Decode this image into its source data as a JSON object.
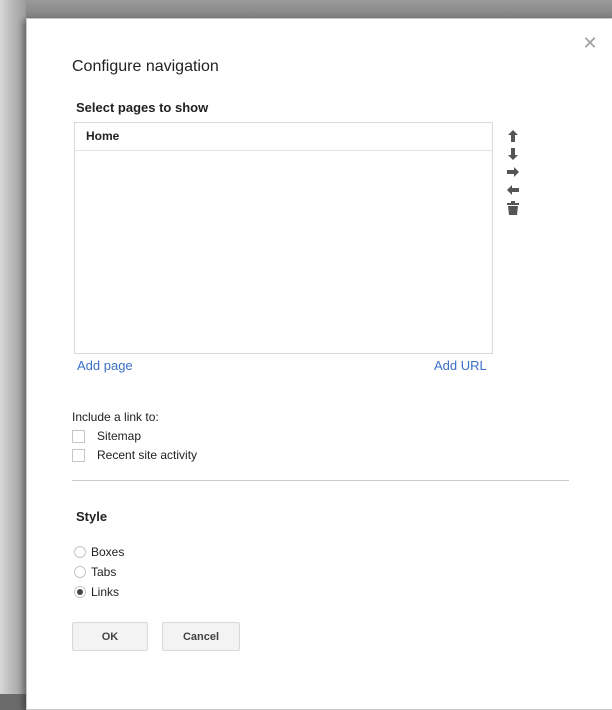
{
  "dialog": {
    "title": "Configure navigation",
    "close_icon": "close-icon"
  },
  "pages_section": {
    "label": "Select pages to show",
    "pages": [
      "Home"
    ],
    "add_page_label": "Add page",
    "add_url_label": "Add URL",
    "tools": [
      "move-up-icon",
      "move-down-icon",
      "indent-right-icon",
      "indent-left-icon",
      "trash-icon"
    ]
  },
  "include_section": {
    "label": "Include a link to:",
    "options": [
      {
        "label": "Sitemap",
        "checked": false
      },
      {
        "label": "Recent site activity",
        "checked": false
      }
    ]
  },
  "style_section": {
    "label": "Style",
    "options": [
      {
        "label": "Boxes",
        "selected": false
      },
      {
        "label": "Tabs",
        "selected": false
      },
      {
        "label": "Links",
        "selected": true
      }
    ]
  },
  "buttons": {
    "ok": "OK",
    "cancel": "Cancel"
  },
  "colors": {
    "link": "#3b6fc9",
    "icon": "#555555"
  }
}
